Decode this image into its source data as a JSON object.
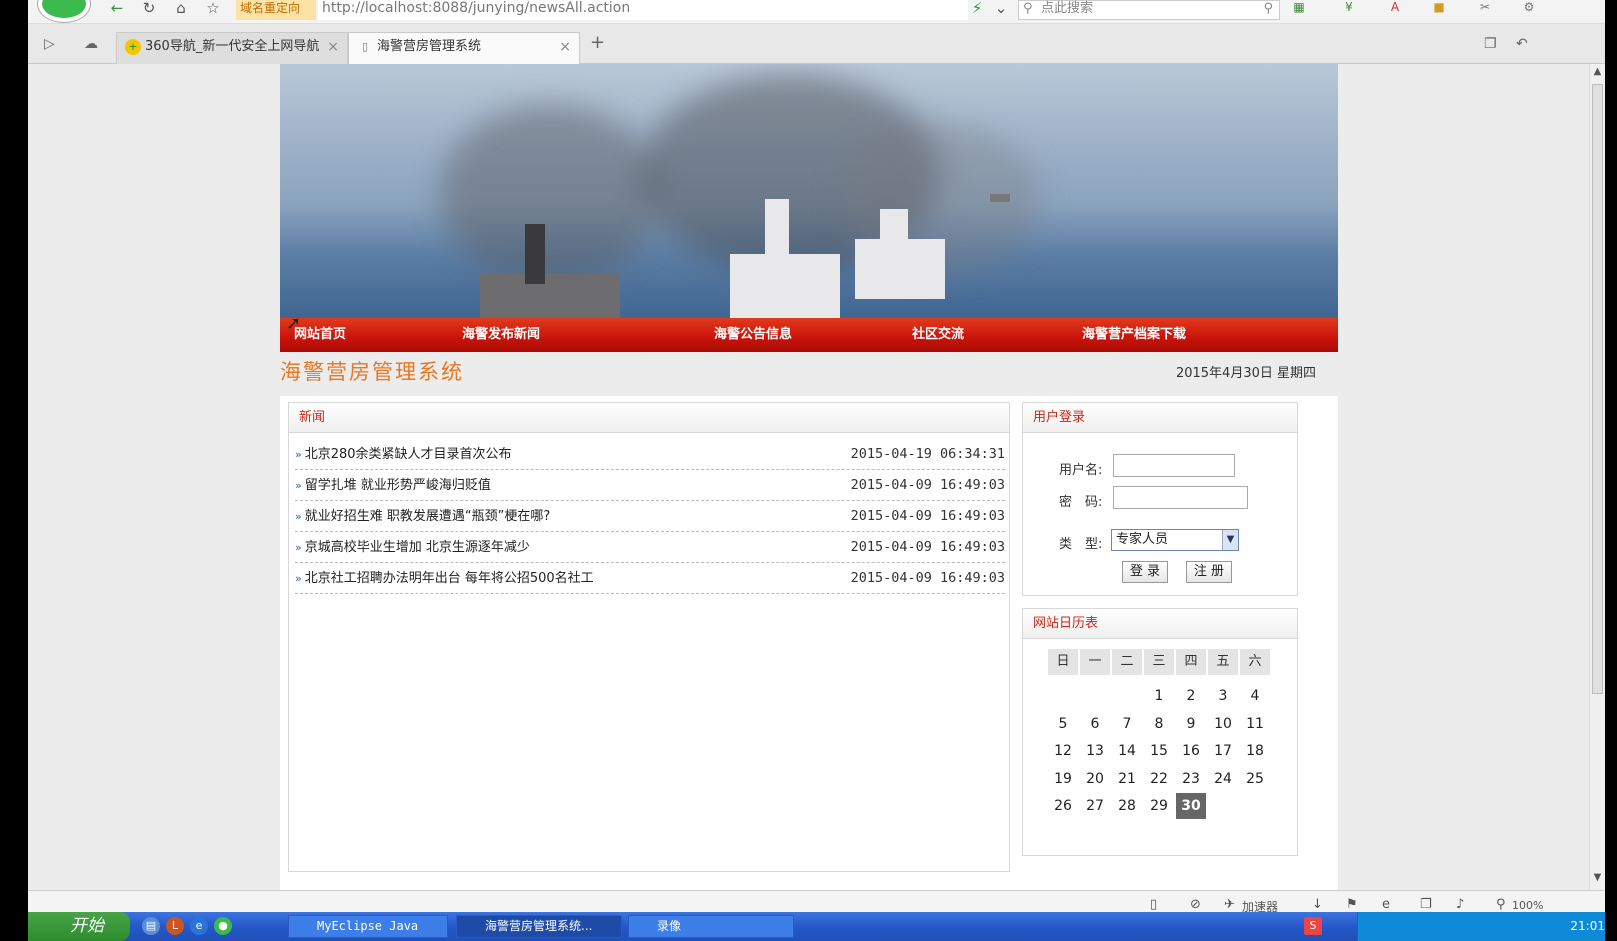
{
  "browser": {
    "redirect_label": "域名重定向",
    "url": "http://localhost:8088/junying/newsAll.action",
    "search_placeholder": "点此搜索",
    "tabs": [
      {
        "label": "360导航_新一代安全上网导航"
      },
      {
        "label": "海警营房管理系统"
      }
    ]
  },
  "site": {
    "menu": [
      "网站首页",
      "海警发布新闻",
      "海警公告信息",
      "社区交流",
      "海警营产档案下载"
    ],
    "title": "海警营房管理系统",
    "date": "2015年4月30日 星期四"
  },
  "news": {
    "heading": "新闻",
    "items": [
      {
        "title": "北京280余类紧缺人才目录首次公布",
        "date": "2015-04-19 06:34:31"
      },
      {
        "title": "留学扎堆 就业形势严峻海归贬值",
        "date": "2015-04-09 16:49:03"
      },
      {
        "title": "就业好招生难 职教发展遭遇“瓶颈”梗在哪?",
        "date": "2015-04-09 16:49:03"
      },
      {
        "title": "京城高校毕业生增加 北京生源逐年减少",
        "date": "2015-04-09 16:49:03"
      },
      {
        "title": "北京社工招聘办法明年出台 每年将公招500名社工",
        "date": "2015-04-09 16:49:03"
      }
    ]
  },
  "login": {
    "heading": "用户登录",
    "username_label": "用户名:",
    "password_label": "密　码:",
    "type_label": "类　型:",
    "type_value": "专家人员",
    "login_button": "登 录",
    "register_button": "注 册"
  },
  "calendar": {
    "heading": "网站日历表",
    "weekdays": [
      "日",
      "一",
      "二",
      "三",
      "四",
      "五",
      "六"
    ],
    "days": [
      "1",
      "2",
      "3",
      "4",
      "5",
      "6",
      "7",
      "8",
      "9",
      "10",
      "11",
      "12",
      "13",
      "14",
      "15",
      "16",
      "17",
      "18",
      "19",
      "20",
      "21",
      "22",
      "23",
      "24",
      "25",
      "26",
      "27",
      "28",
      "29",
      "30"
    ],
    "today": "30"
  },
  "statusbar": {
    "accelerator": "加速器",
    "zoom": "100%"
  },
  "taskbar": {
    "start_label": "开始",
    "tasks": [
      "MyEclipse Java E...",
      "海警营房管理系统...",
      "录像"
    ],
    "clock": "21:01"
  }
}
